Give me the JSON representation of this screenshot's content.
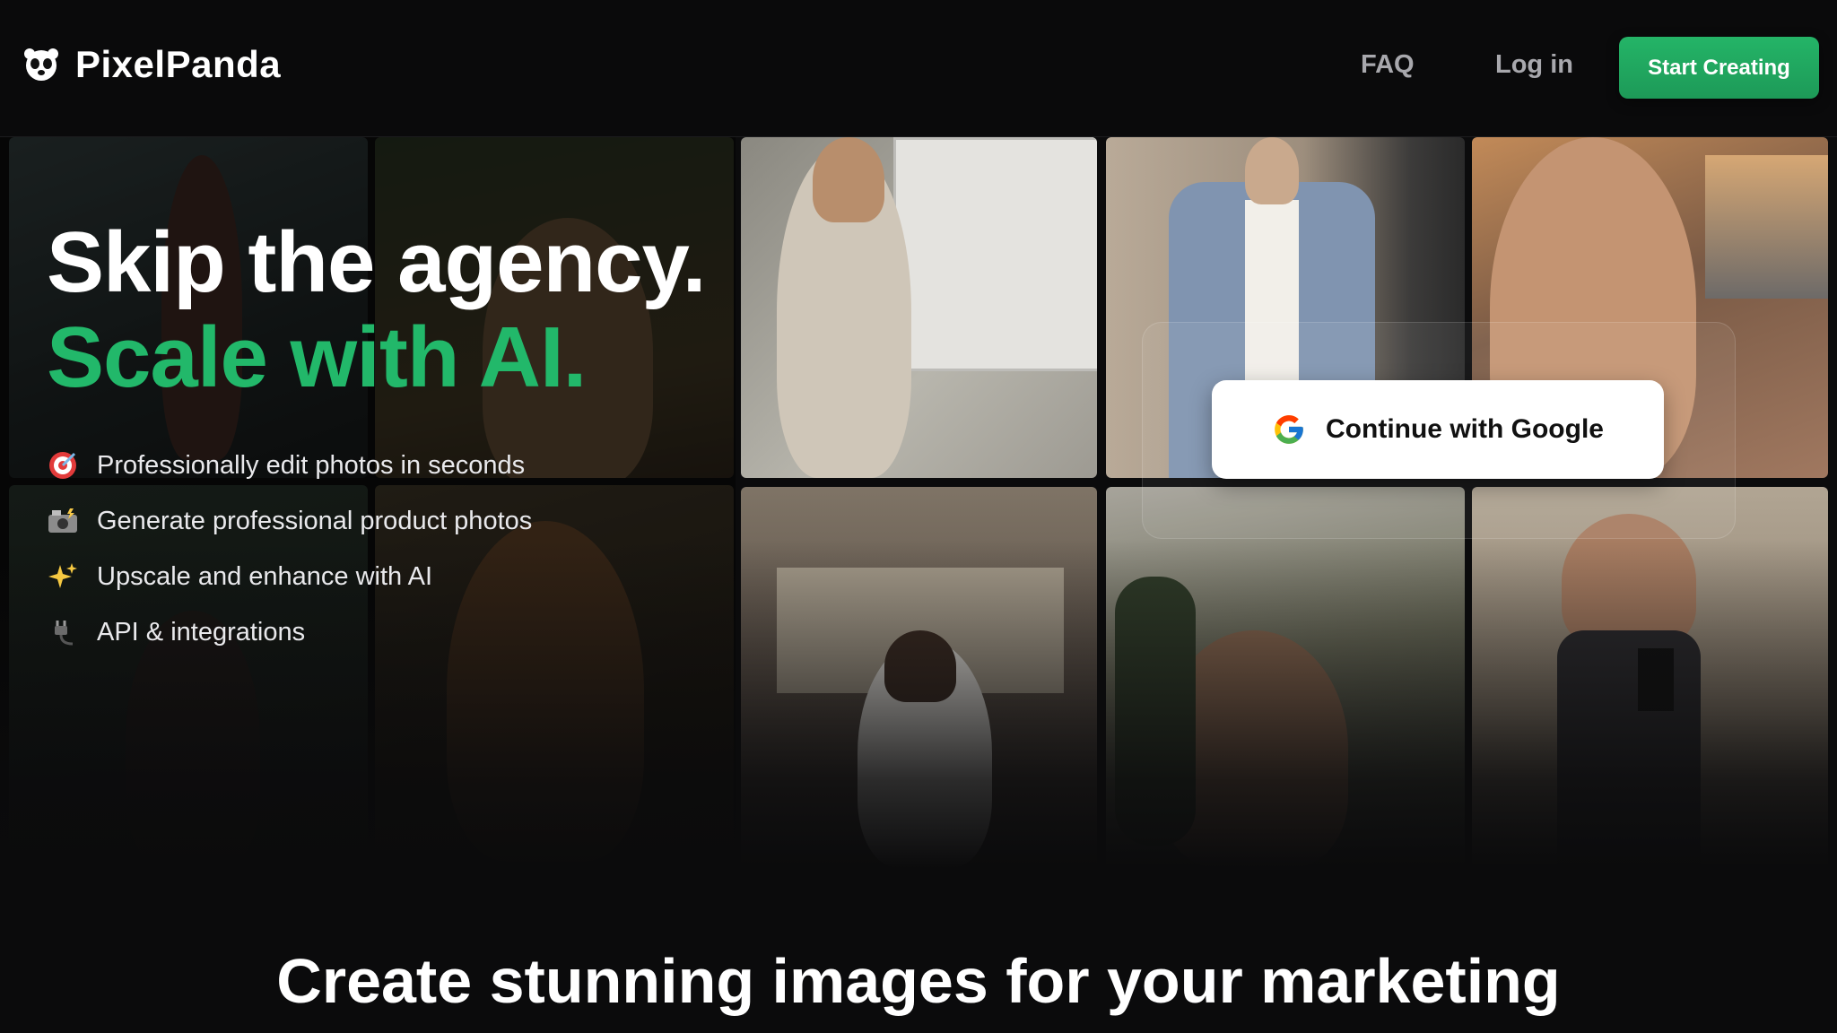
{
  "brand": {
    "name": "PixelPanda",
    "icon": "panda-icon"
  },
  "nav": {
    "faq": "FAQ",
    "login": "Log in",
    "cta": "Start Creating"
  },
  "hero": {
    "line1": "Skip the agency.",
    "line2": "Scale with AI.",
    "features": [
      {
        "icon": "target-icon",
        "label": "Professionally edit photos in seconds"
      },
      {
        "icon": "camera-flash-icon",
        "label": "Generate professional product photos"
      },
      {
        "icon": "sparkles-icon",
        "label": "Upscale and enhance with AI"
      },
      {
        "icon": "plug-icon",
        "label": "API & integrations"
      }
    ]
  },
  "auth": {
    "google_label": "Continue with Google"
  },
  "section": {
    "title": "Create stunning images for your marketing"
  },
  "colors": {
    "accent": "#22b86a",
    "background": "#0b0b0c"
  }
}
